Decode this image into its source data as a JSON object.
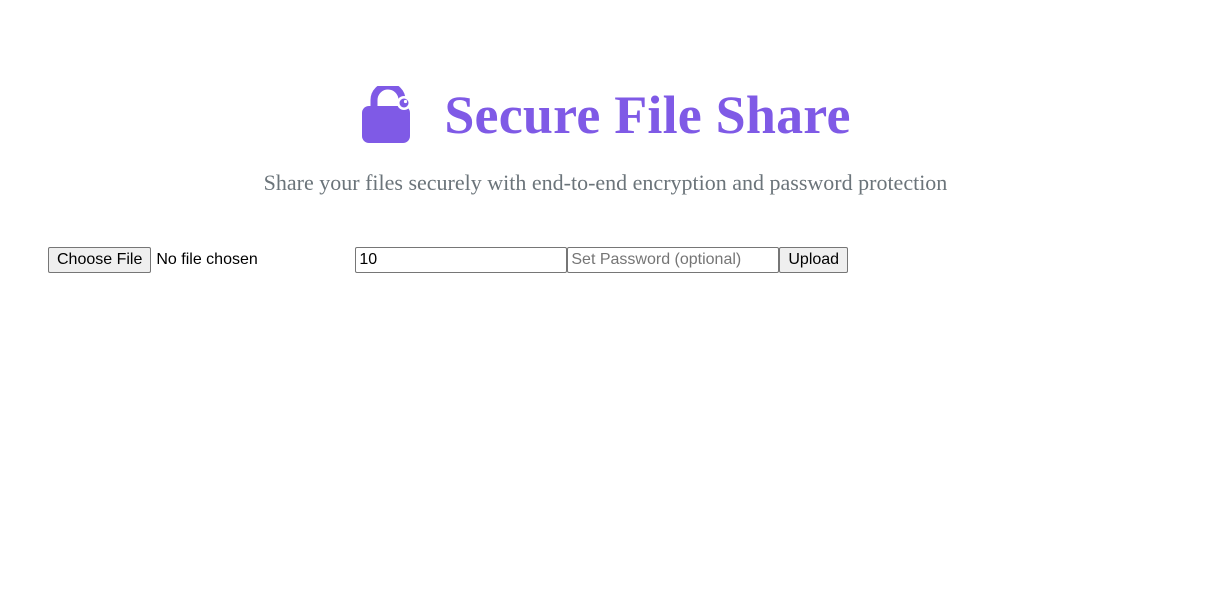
{
  "header": {
    "title": "Secure File Share",
    "icon": "lock-icon",
    "accent_color": "#7f5ae6"
  },
  "subtitle": "Share your files securely with end-to-end encryption and password protection",
  "form": {
    "choose_file_label": "Choose File",
    "file_status": "No file chosen",
    "expiry_value": "10",
    "password_placeholder": "Set Password (optional)",
    "upload_label": "Upload"
  }
}
